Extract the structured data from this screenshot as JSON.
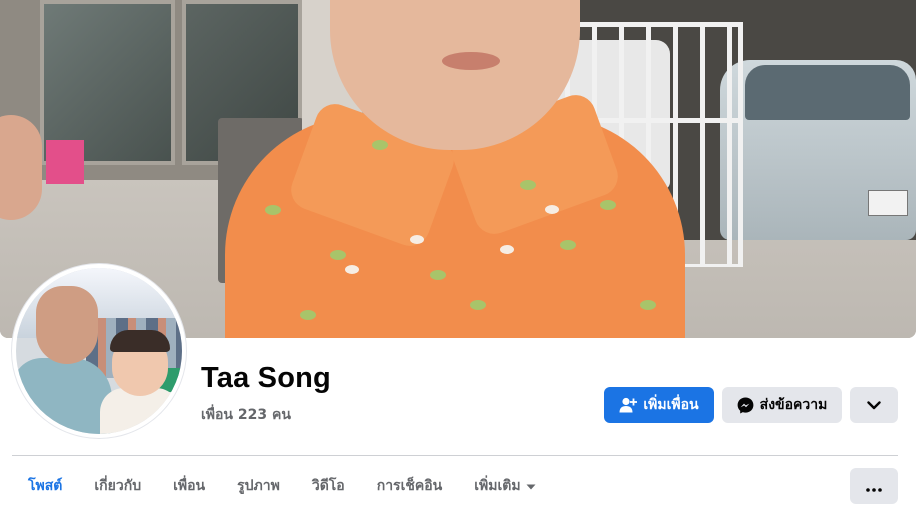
{
  "profile": {
    "name": "Taa Song",
    "friends_count_label": "เพื่อน 223 คน"
  },
  "actions": {
    "add_friend_label": "เพิ่มเพื่อน",
    "message_label": "ส่งข้อความ",
    "add_friend_icon": "person-plus-icon",
    "message_icon": "messenger-icon",
    "more_icon": "chevron-down-icon"
  },
  "tabs": [
    {
      "label": "โพสต์",
      "active": true
    },
    {
      "label": "เกี่ยวกับ",
      "active": false
    },
    {
      "label": "เพื่อน",
      "active": false
    },
    {
      "label": "รูปภาพ",
      "active": false
    },
    {
      "label": "วิดีโอ",
      "active": false
    },
    {
      "label": "การเช็คอิน",
      "active": false
    },
    {
      "label": "เพิ่มเติม",
      "active": false,
      "icon": "caret-down-icon"
    }
  ],
  "tab_overflow_icon": "ellipsis-icon",
  "colors": {
    "accent": "#1b74e4",
    "secondary_button": "#e4e6eb",
    "secondary_text": "#65676b"
  }
}
